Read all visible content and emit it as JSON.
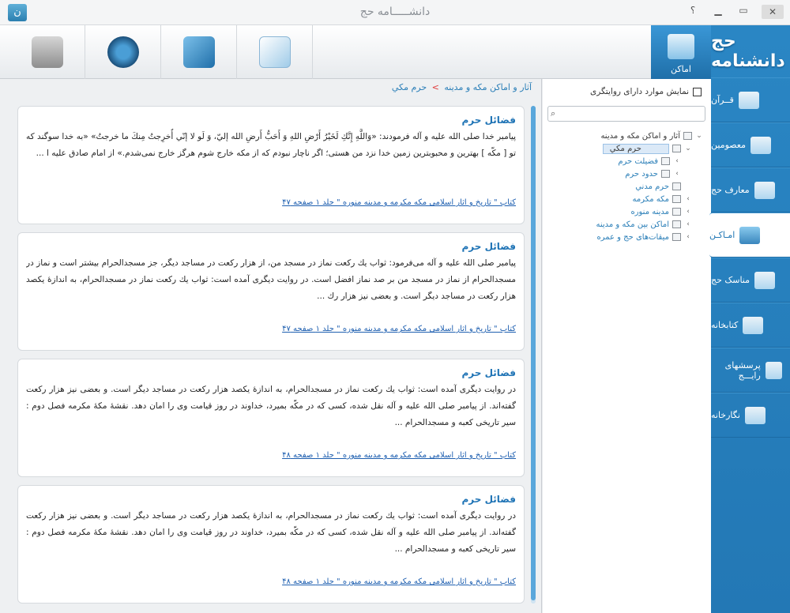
{
  "window": {
    "title": "دانشـــــامه حج",
    "help": "؟",
    "minimize": "▁",
    "restore": "▭",
    "close": "✕"
  },
  "nav": {
    "logo": "حج دانشنامه",
    "items": [
      {
        "label": "قــرآن",
        "icon": "book-icon"
      },
      {
        "label": "معصومین",
        "icon": "shrine-icon"
      },
      {
        "label": "معارف حج",
        "icon": "kaaba-icon"
      },
      {
        "label": "امـاکـن",
        "icon": "mosque-icon",
        "active": true
      },
      {
        "label": "مناسک حج",
        "icon": "pilgrim-icon"
      },
      {
        "label": "کتابخانه",
        "icon": "library-icon"
      },
      {
        "label": "پرسشهای رایـــج",
        "icon": "faq-icon"
      },
      {
        "label": "نگارخانه",
        "icon": "gallery-icon"
      }
    ]
  },
  "toolbar": {
    "active_label": "اماکن"
  },
  "breadcrumb": {
    "parent": "آثار و اماکن مکه و مدینه",
    "sep": ">",
    "current": "حرم مكي"
  },
  "filter": {
    "label": "نمایش موارد دارای روایتگری"
  },
  "tree": {
    "items": [
      {
        "label": "آثار و اماکن مکه و مدینه",
        "level": 0,
        "arrow": "⌄"
      },
      {
        "label": "حرم مكي",
        "level": 1,
        "arrow": "⌄",
        "selected": true
      },
      {
        "label": "فضيلت حرم",
        "level": 2,
        "arrow": "›",
        "blue": true
      },
      {
        "label": "حدود حرم",
        "level": 2,
        "arrow": "›",
        "blue": true
      },
      {
        "label": "حرم مدني",
        "level": 1,
        "arrow": "",
        "blue": true
      },
      {
        "label": "مکه مکرمه",
        "level": 1,
        "arrow": "›",
        "blue": true
      },
      {
        "label": "مدینه منوره",
        "level": 1,
        "arrow": "›",
        "blue": true
      },
      {
        "label": "اماکن بین مکه و مدینه",
        "level": 1,
        "arrow": "›",
        "blue": true
      },
      {
        "label": "میقات‌های حج و عمره",
        "level": 1,
        "arrow": "›",
        "blue": true
      }
    ]
  },
  "cards": [
    {
      "title": "فضائل حرم",
      "body": "پیامبر خدا صلی الله علیه و آله فرمودند: «وَاللَّهِ إِنَّكِ لَخَيْرُ أَرْضِ اللهِ وَ أَحَبُّ أَرضِ الله إليّ، وَ لَو لا إنّي أُخرِجتُ مِنكَ ما خرجتُ» «به خدا سوگند که تو [ مکّه ] بهترین و محبوبترین زمین خدا نزد من هستی؛ اگر ناچار نبودم که از مکه خارج شوم هرگز خارج نمی‌شدم.» از امام صادق علیه ا ...",
      "source": "کتاب \" تاریخ و آثار اسلامی مکه مکرمه و مدینه منوره \" جلد ۱ صفحه ۴۷"
    },
    {
      "title": "فضائل حرم",
      "body": "پیامبر صلی الله علیه و آله می‌فرمود: ثواب یك رکعت نماز در مسجد من، از هزار رکعت در مساجد دیگر، جز مسجدالحرام بیشتر است و نماز در مسجدالحرام از نماز در مسجد من بر صد نماز افضل است. در روایت دیگری آمده است: ثواب یك رکعت نماز در مسجدالحرام، به اندازهٔ یکصد هزار رکعت در مساجد دیگر است. و بعضی نیز هزار رك ...",
      "source": "کتاب \" تاریخ و آثار اسلامی مکه مکرمه و مدینه منوره \" جلد ۱ صفحه ۴۷"
    },
    {
      "title": "فضائل حرم",
      "body": "در روایت دیگری آمده است: ثواب یك رکعت نماز در مسجدالحرام، به اندازهٔ یکصد هزار رکعت در مساجد دیگر است. و بعضی نیز هزار رکعت گفته‌اند. از پیامبر صلی الله علیه و آله نقل شده، کسی که در مکّه بمیرد، خداوند در روز قیامت وی را امان دهد. نقشهٔ مکهٔ مکرمه فصل دوم : سیر تاریخی کعبه و مسجدالحرام ...",
      "source": "کتاب \" تاریخ و آثار اسلامی مکه مکرمه و مدینه منوره \" جلد ۱ صفحه ۴۸"
    },
    {
      "title": "فضائل حرم",
      "body": "در روایت دیگری آمده است: ثواب یك رکعت نماز در مسجدالحرام، به اندازهٔ یکصد هزار رکعت در مساجد دیگر است. و بعضی نیز هزار رکعت گفته‌اند. از پیامبر صلی الله علیه و آله نقل شده، کسی که در مکّه بمیرد، خداوند در روز قیامت وی را امان دهد. نقشهٔ مکهٔ مکرمه فصل دوم : سیر تاریخی کعبه و مسجدالحرام ...",
      "source": "کتاب \" تاریخ و آثار اسلامی مکه مکرمه و مدینه منوره \" جلد ۱ صفحه ۴۸"
    }
  ]
}
